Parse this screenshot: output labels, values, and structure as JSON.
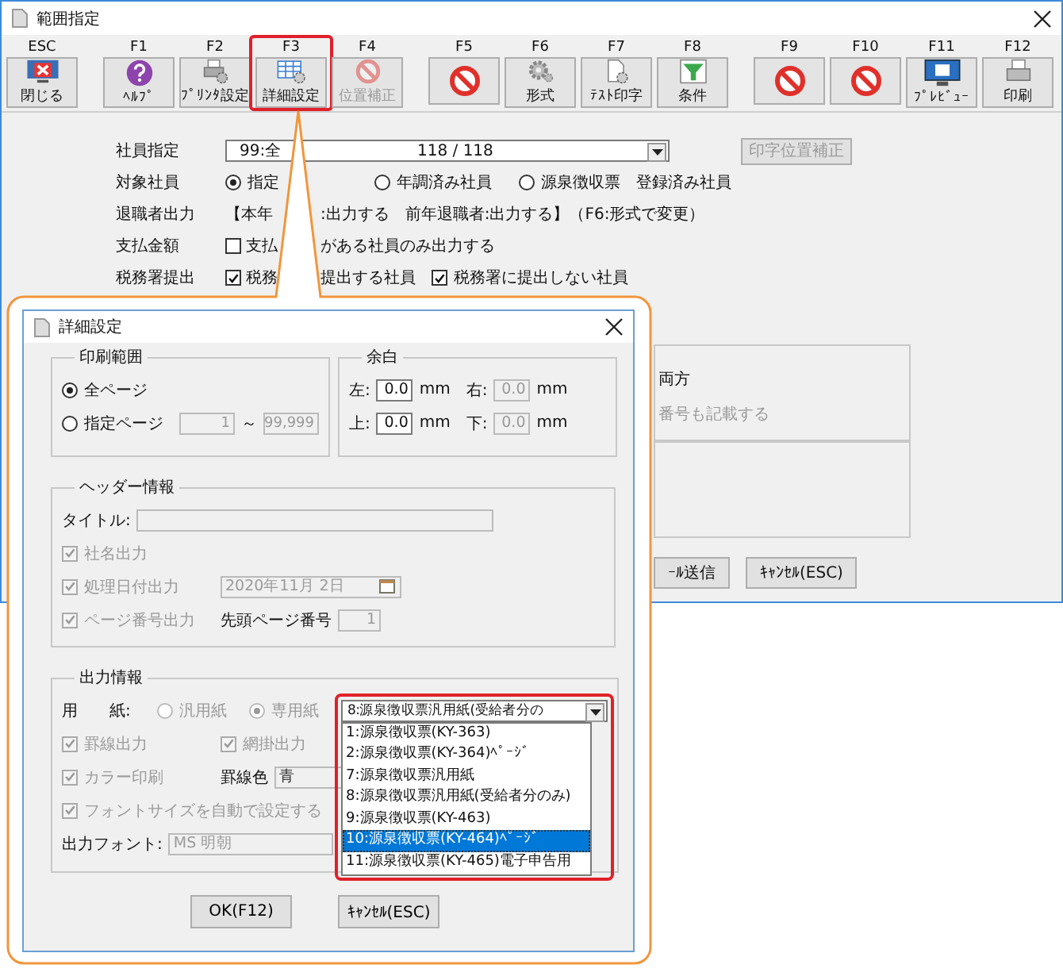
{
  "window": {
    "title": "範囲指定"
  },
  "toolbar_groups": [
    [
      {
        "key": "ESC",
        "label": "閉じる",
        "kind": "close",
        "disabled": false,
        "highlighted": false
      }
    ],
    [
      {
        "key": "F1",
        "label": "ﾍﾙﾌﾟ",
        "kind": "help",
        "disabled": false,
        "highlighted": false
      },
      {
        "key": "F2",
        "label": "ﾌﾟﾘﾝﾀ設定",
        "kind": "printer_gear",
        "disabled": false,
        "highlighted": false
      },
      {
        "key": "F3",
        "label": "詳細設定",
        "kind": "table_gear",
        "disabled": false,
        "highlighted": true
      },
      {
        "key": "F4",
        "label": "位置補正",
        "kind": "no_entry",
        "disabled": true,
        "highlighted": false
      }
    ],
    [
      {
        "key": "F5",
        "kind": "no_entry",
        "disabled": false,
        "highlighted": false
      },
      {
        "key": "F6",
        "label": "形式",
        "kind": "gear",
        "disabled": false,
        "highlighted": false
      },
      {
        "key": "F7",
        "label": "ﾃｽﾄ印字",
        "kind": "document_gear",
        "disabled": false,
        "highlighted": false
      },
      {
        "key": "F8",
        "label": "条件",
        "kind": "funnel",
        "disabled": false,
        "highlighted": false
      }
    ],
    [
      {
        "key": "F9",
        "kind": "no_entry",
        "disabled": false,
        "highlighted": false
      },
      {
        "key": "F10",
        "kind": "no_entry",
        "disabled": false,
        "highlighted": false
      },
      {
        "key": "F11",
        "label": "ﾌﾟﾚﾋﾞｭｰ",
        "kind": "monitor",
        "disabled": false,
        "highlighted": false
      },
      {
        "key": "F12",
        "label": "印刷",
        "kind": "printer",
        "disabled": false,
        "highlighted": false
      }
    ]
  ],
  "form": {
    "employee": {
      "label": "社員指定",
      "value": "99:全",
      "count": "118 / 118",
      "button": {
        "label": "印字位置補正",
        "disabled": true
      }
    },
    "target": {
      "label": "対象社員",
      "options": [
        {
          "label": "指定",
          "selected": true
        },
        {
          "label": "年調済み社員",
          "selected": false
        },
        {
          "label": "源泉徴収票　登録済み社員",
          "selected": false
        }
      ]
    },
    "retiree": {
      "label": "退職者出力",
      "text_start": "【本年",
      "text_end": ":出力する　前年退職者:出力する】（F6:形式で変更）"
    },
    "payment": {
      "label": "支払金額",
      "checked": false,
      "text_start": "支払",
      "text_end": "がある社員のみ出力する"
    },
    "tax_office": {
      "label": "税務署提出",
      "options": [
        {
          "label_start": "税務",
          "label_end": "提出する社員",
          "checked": true
        },
        {
          "label": "税務署に提出しない社員",
          "checked": true
        }
      ]
    }
  },
  "side_panel": {
    "texts": [
      {
        "text": "両方",
        "disabled": false
      },
      {
        "text": "番号も記載する",
        "disabled": true
      }
    ],
    "buttons": [
      "ｰﾙ送信",
      "ｷｬﾝｾﾙ(ESC)"
    ]
  },
  "dialog": {
    "title": "詳細設定",
    "print_range": {
      "title": "印刷範囲",
      "options": [
        {
          "label": "全ページ",
          "selected": true
        },
        {
          "label": "指定ページ",
          "selected": false
        }
      ],
      "from": "1",
      "separator": "～",
      "to": "99,999"
    },
    "margins": {
      "title": "余白",
      "fields": [
        {
          "label": "左:",
          "value": "0.0",
          "unit": "mm",
          "disabled": false
        },
        {
          "label": "右:",
          "value": "0.0",
          "unit": "mm",
          "disabled": true
        },
        {
          "label": "上:",
          "value": "0.0",
          "unit": "mm",
          "disabled": false
        },
        {
          "label": "下:",
          "value": "0.0",
          "unit": "mm",
          "disabled": true
        }
      ]
    },
    "header": {
      "title": "ヘッダー情報",
      "title_label": "タイトル:",
      "checks": [
        {
          "label": "社名出力",
          "checked": true,
          "disabled": true
        },
        {
          "label": "処理日付出力",
          "checked": true,
          "disabled": true
        },
        {
          "label": "ページ番号出力",
          "checked": true,
          "disabled": true
        }
      ],
      "date": "2020年11月 2日",
      "first_page": {
        "label": "先頭ページ番号",
        "value": "1"
      }
    },
    "output": {
      "title": "出力情報",
      "paper_label": "用　　紙:",
      "paper_options": [
        {
          "label": "汎用紙",
          "selected": false,
          "disabled": true
        },
        {
          "label": "専用紙",
          "selected": true,
          "disabled": true
        }
      ],
      "paper_select": {
        "value": "8:源泉徴収票汎用紙(受給者分の",
        "highlighted": true,
        "expanded": true,
        "items": [
          {
            "label": "1:源泉徴収票(KY-363)",
            "selected": false
          },
          {
            "label": "2:源泉徴収票(KY-364)ﾍﾟｰｼﾞ",
            "selected": false
          },
          {
            "label": "7:源泉徴収票汎用紙",
            "selected": false
          },
          {
            "label": "8:源泉徴収票汎用紙(受給者分のみ)",
            "selected": false
          },
          {
            "label": "9:源泉徴収票(KY-463)",
            "selected": false
          },
          {
            "label": "10:源泉徴収票(KY-464)ﾍﾟｰｼﾞ",
            "selected": true
          },
          {
            "label": "11:源泉徴収票(KY-465)電子申告用",
            "selected": false
          }
        ]
      },
      "checks": [
        {
          "label": "罫線出力",
          "checked": true,
          "disabled": true
        },
        {
          "label": "網掛出力",
          "checked": true,
          "disabled": true
        },
        {
          "label": "カラー印刷",
          "checked": true,
          "disabled": true
        },
        {
          "label": "フォントサイズを自動で設定する",
          "checked": true,
          "disabled": true
        }
      ],
      "line_color": {
        "label": "罫線色",
        "value": "青"
      },
      "font": {
        "label": "出力フォント:",
        "value": "MS 明朝"
      }
    },
    "buttons": [
      "OK(F12)",
      "ｷｬﾝｾﾙ(ESC)"
    ]
  }
}
